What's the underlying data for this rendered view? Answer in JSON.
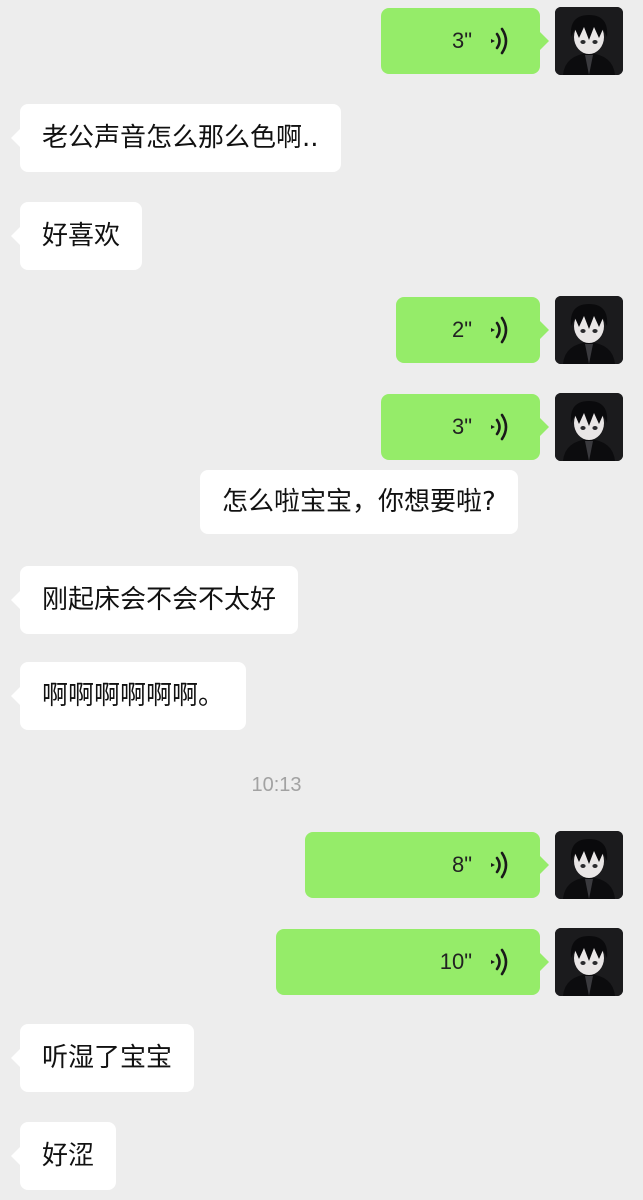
{
  "messages": {
    "voice_1": "3\"",
    "text_1": "老公声音怎么那么色啊..",
    "text_2": "好喜欢",
    "voice_2": "2\"",
    "voice_3": "3\"",
    "text_3": "怎么啦宝宝，你想要啦?",
    "text_4": "刚起床会不会不太好",
    "text_5": "啊啊啊啊啊啊。",
    "timestamp": "10:13",
    "voice_4": "8\"",
    "voice_5": "10\"",
    "text_6": "听湿了宝宝",
    "text_7": "好涩"
  },
  "icons": {
    "voice": "voice-wave-icon",
    "avatar": "anime-boy-avatar"
  },
  "colors": {
    "background": "#ededed",
    "outgoing_bubble": "#95ec69",
    "incoming_bubble": "#ffffff",
    "timestamp_text": "#a2a2a2"
  }
}
